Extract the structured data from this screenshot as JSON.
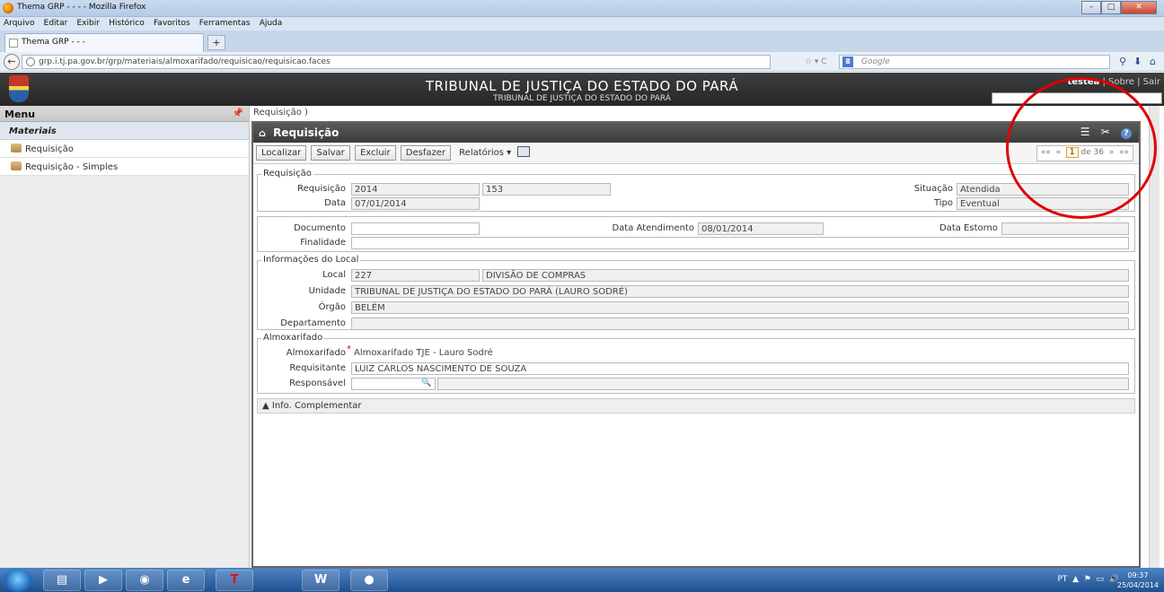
{
  "browser": {
    "window_title": "Thema GRP - - - - Mozilla Firefox",
    "menu": [
      "Arquivo",
      "Editar",
      "Exibir",
      "Histórico",
      "Favoritos",
      "Ferramentas",
      "Ajuda"
    ],
    "tab_title": "Thema GRP - - -",
    "new_tab": "+",
    "url": "grp.i.tj.pa.gov.br/grp/materiais/almoxarifado/requisicao/requisicao.faces",
    "search_placeholder": "Google",
    "search_engine_icon": "8"
  },
  "header": {
    "title": "TRIBUNAL DE JUSTIÇA DO ESTADO DO PARÁ",
    "subtitle": "TRIBUNAL DE JUSTIÇA DO ESTADO DO PARÁ",
    "user": "testea",
    "sobre": "Sobre",
    "sair": "Sair"
  },
  "sidebar": {
    "title": "Menu",
    "section": "Materiais",
    "items": [
      {
        "label": "Requisição"
      },
      {
        "label": "Requisição - Simples"
      }
    ]
  },
  "breadcrumb": "Requisição )",
  "panel": {
    "title": "Requisição",
    "toolbar": {
      "localizar": "Localizar",
      "salvar": "Salvar",
      "excluir": "Excluir",
      "desfazer": "Desfazer",
      "relatorios": "Relatórios ▾"
    },
    "pager": {
      "first": "««",
      "prev": "«",
      "current": "1",
      "of": "de 36",
      "next": "»",
      "last": "»»"
    }
  },
  "requisicao": {
    "legend": "Requisição",
    "requisicao_label": "Requisição",
    "requisicao_ano": "2014",
    "requisicao_num": "153",
    "data_label": "Data",
    "data": "07/01/2014",
    "situacao_label": "Situação",
    "situacao": "Atendida",
    "tipo_label": "Tipo",
    "tipo": "Eventual"
  },
  "documento": {
    "documento_label": "Documento",
    "documento": "",
    "data_atendimento_label": "Data Atendimento",
    "data_atendimento": "08/01/2014",
    "data_estorno_label": "Data Estorno",
    "data_estorno": "",
    "finalidade_label": "Finalidade",
    "finalidade": ""
  },
  "local": {
    "legend": "Informações do Local",
    "local_label": "Local",
    "local_code": "227",
    "local_name": "DIVISÃO DE COMPRAS",
    "unidade_label": "Unidade",
    "unidade": "TRIBUNAL DE JUSTIÇA DO ESTADO DO PARÁ (LAURO SODRÉ)",
    "orgao_label": "Órgão",
    "orgao": "BELÉM",
    "departamento_label": "Departamento",
    "departamento": ""
  },
  "almox": {
    "legend": "Almoxarifado",
    "almox_label": "Almoxarifado",
    "almox": "Almoxarifado TJE - Lauro Sodré",
    "requisitante_label": "Requisitante",
    "requisitante": "LUIZ CARLOS NASCIMENTO DE SOUZA",
    "responsavel_label": "Responsável",
    "responsavel": ""
  },
  "info_complementar": "▲ Info. Complementar",
  "taskbar": {
    "tray_lang": "PT",
    "time": "09:37",
    "date": "25/04/2014"
  }
}
